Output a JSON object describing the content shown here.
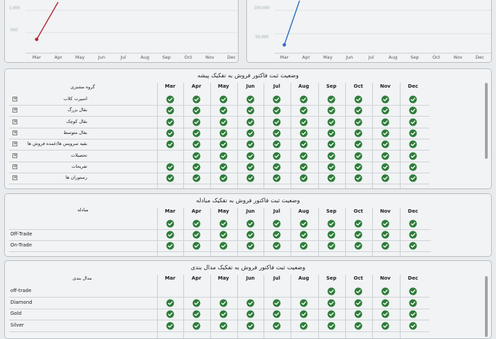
{
  "chart_left": {
    "x_labels": [
      "Mar",
      "Apr",
      "May",
      "Jun",
      "Jul",
      "Aug",
      "Sep",
      "Oct",
      "Nov",
      "Dec"
    ],
    "y_top": "1,000",
    "y_mid": "500",
    "color": "#b42b35"
  },
  "chart_right": {
    "x_labels": [
      "Mar",
      "Apr",
      "May",
      "Jun",
      "Jul",
      "Aug",
      "Sep",
      "Oct",
      "Nov",
      "Dec"
    ],
    "y_top": "100,000",
    "y_mid": "50,000",
    "color": "#2f6fc4"
  },
  "months": [
    "Mar",
    "Apr",
    "May",
    "Jun",
    "Jul",
    "Aug",
    "Sep",
    "Oct",
    "Nov",
    "Dec"
  ],
  "table1": {
    "title": "وضعیت ثبت فاکتور فروش به تفکیک پیشه",
    "row_header": "گروه مشتری",
    "rows": [
      {
        "label": "اسپرت کلاب",
        "checks": [
          1,
          1,
          1,
          1,
          1,
          1,
          1,
          1,
          1,
          1
        ]
      },
      {
        "label": "بقال بزرگ",
        "checks": [
          1,
          1,
          1,
          1,
          1,
          1,
          1,
          1,
          1,
          1
        ]
      },
      {
        "label": "بقال کوچک",
        "checks": [
          1,
          1,
          1,
          1,
          1,
          1,
          1,
          1,
          1,
          1
        ]
      },
      {
        "label": "بقال متوسط",
        "checks": [
          1,
          1,
          1,
          1,
          1,
          1,
          1,
          1,
          1,
          1
        ]
      },
      {
        "label": "بقیه سرویس ها/عمده فروش ها",
        "checks": [
          1,
          1,
          1,
          1,
          1,
          1,
          1,
          1,
          1,
          1
        ]
      },
      {
        "label": "تحصیلات",
        "checks": [
          0,
          1,
          1,
          1,
          1,
          1,
          1,
          1,
          1,
          1
        ]
      },
      {
        "label": "تفریحات",
        "checks": [
          1,
          1,
          1,
          1,
          1,
          1,
          1,
          1,
          1,
          1
        ]
      },
      {
        "label": "رستوران ها",
        "checks": [
          1,
          1,
          1,
          1,
          1,
          1,
          1,
          1,
          1,
          1
        ]
      }
    ]
  },
  "table2": {
    "title": "وضعیت ثبت فاکتور فروش به تفکیک مبادله",
    "row_header": "مبادله",
    "rows": [
      {
        "label": "",
        "checks": [
          1,
          1,
          1,
          1,
          1,
          1,
          1,
          1,
          1,
          1
        ]
      },
      {
        "label": "Off-Trade",
        "checks": [
          1,
          1,
          1,
          1,
          1,
          1,
          1,
          1,
          1,
          1
        ]
      },
      {
        "label": "On-Trade",
        "checks": [
          1,
          1,
          1,
          1,
          1,
          1,
          1,
          1,
          1,
          1
        ]
      }
    ]
  },
  "table3": {
    "title": "وضعیت ثبت فاکتور فروش به تفکیک مدال بندی",
    "row_header": "مدال بندی",
    "rows": [
      {
        "label": "off-trade",
        "checks": [
          0,
          0,
          0,
          0,
          0,
          0,
          1,
          1,
          1,
          1
        ]
      },
      {
        "label": "Diamond",
        "checks": [
          1,
          1,
          1,
          1,
          1,
          1,
          1,
          1,
          1,
          1
        ]
      },
      {
        "label": "Gold",
        "checks": [
          1,
          1,
          1,
          1,
          1,
          1,
          1,
          1,
          1,
          1
        ]
      },
      {
        "label": "Silver",
        "checks": [
          1,
          1,
          1,
          1,
          1,
          1,
          1,
          1,
          1,
          1
        ]
      }
    ]
  },
  "colors": {
    "check": "#2e7d3a",
    "accent_red": "#b42b35",
    "accent_blue": "#2f6fc4"
  }
}
